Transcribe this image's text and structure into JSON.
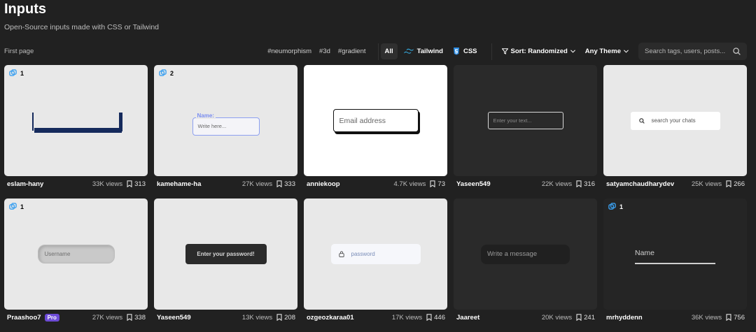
{
  "header": {
    "title": "Inputs",
    "subtitle": "Open-Source inputs made with CSS or Tailwind"
  },
  "toolbar": {
    "page_label": "First page",
    "tags": [
      "#neumorphism",
      "#3d",
      "#gradient"
    ],
    "filter_all": "All",
    "filter_tailwind": "Tailwind",
    "filter_css": "CSS",
    "sort_label": "Sort: Randomized",
    "theme_label": "Any Theme",
    "search_placeholder": "Search tags, users, posts..."
  },
  "colors": {
    "background": "#212121",
    "accent_blue": "#3aa0f0",
    "pro_badge": "#6d4bd6"
  },
  "cards": [
    {
      "author": "eslam-hany",
      "views": "33K views",
      "saves": "313",
      "badge_count": "1"
    },
    {
      "author": "kamehame-ha",
      "views": "27K views",
      "saves": "333",
      "badge_count": "2",
      "preview_label": "Name:",
      "preview_placeholder": "Write here..."
    },
    {
      "author": "anniekoop",
      "views": "4.7K views",
      "saves": "73",
      "preview_placeholder": "Email address"
    },
    {
      "author": "Yaseen549",
      "views": "22K views",
      "saves": "316",
      "preview_placeholder": "Enter your text..."
    },
    {
      "author": "satyamchaudharydev",
      "views": "25K views",
      "saves": "266",
      "preview_placeholder": "search your chats"
    },
    {
      "author": "Praashoo7",
      "pro": "Pro",
      "views": "27K views",
      "saves": "338",
      "badge_count": "1",
      "preview_placeholder": "Username"
    },
    {
      "author": "Yaseen549",
      "views": "13K views",
      "saves": "208",
      "preview_placeholder": "Enter your password!"
    },
    {
      "author": "ozgeozkaraa01",
      "views": "17K views",
      "saves": "446",
      "preview_placeholder": "password"
    },
    {
      "author": "Jaareet",
      "views": "20K views",
      "saves": "241",
      "preview_placeholder": "Write a message"
    },
    {
      "author": "mrhyddenn",
      "views": "36K views",
      "saves": "756",
      "badge_count": "1",
      "preview_placeholder": "Name"
    }
  ]
}
